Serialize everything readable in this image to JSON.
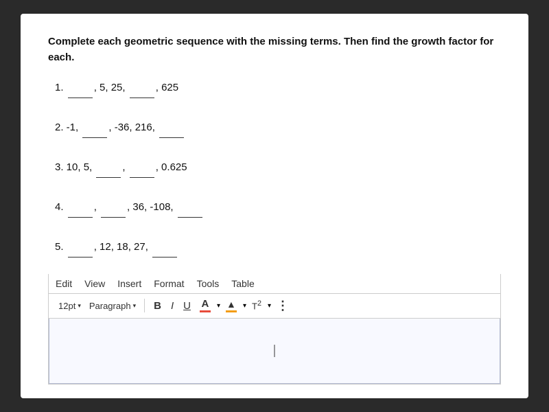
{
  "page": {
    "background_color": "#2a2a2a"
  },
  "question": {
    "title": "Complete each geometric sequence with the missing terms. Then find the growth factor for each.",
    "problems": [
      {
        "number": "1.",
        "text_parts": [
          "1.",
          " ____, 5, 25, ____, 625"
        ]
      },
      {
        "number": "2.",
        "text_parts": [
          "2.",
          " -1, ____, -36, 216, ____"
        ]
      },
      {
        "number": "3.",
        "text_parts": [
          "3.",
          " 10, 5, ____, ____, 0.625"
        ]
      },
      {
        "number": "4.",
        "text_parts": [
          "4.",
          " ____, ____, 36, -108, ____"
        ]
      },
      {
        "number": "5.",
        "text_parts": [
          "5.",
          " ____, 12, 18, 27, ____"
        ]
      }
    ]
  },
  "editor": {
    "menu": {
      "items": [
        "Edit",
        "View",
        "Insert",
        "Format",
        "Tools",
        "Table"
      ]
    },
    "toolbar": {
      "font_size": "12pt",
      "font_size_arrow": "▾",
      "paragraph": "Paragraph",
      "paragraph_arrow": "▾",
      "bold_label": "B",
      "italic_label": "I",
      "underline_label": "U",
      "font_color_label": "A",
      "highlight_label": "▲",
      "superscript_label": "T²",
      "more_label": "⋮"
    }
  }
}
